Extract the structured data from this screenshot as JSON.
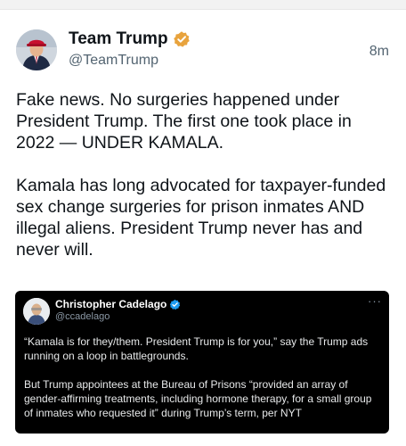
{
  "author": {
    "display_name": "Team Trump",
    "handle": "@TeamTrump",
    "timestamp": "8m"
  },
  "post": {
    "text": "Fake news. No surgeries happened under President Trump. The first one took place in 2022 — UNDER KAMALA.\n\nKamala has long advocated for taxpayer-funded sex change surgeries for prison inmates AND illegal aliens. President Trump never has and never will."
  },
  "quote": {
    "display_name": "Christopher Cadelago",
    "handle": "@ccadelago",
    "more": "···",
    "text": "“Kamala is for they/them. President Trump is for you,” say the Trump ads running on a loop in battlegrounds.\n\nBut Trump appointees at the Bureau of Prisons “provided an array of gender-affirming treatments, including hormone therapy, for a small group of inmates who requested it” during Trump’s term, per NYT"
  },
  "colors": {
    "verified_gold": "#e8a33d",
    "verified_blue": "#1d9bf0",
    "quote_background": "#000000"
  },
  "icons": {
    "author_verified": "verified-badge-icon",
    "quote_verified": "verified-badge-icon"
  }
}
